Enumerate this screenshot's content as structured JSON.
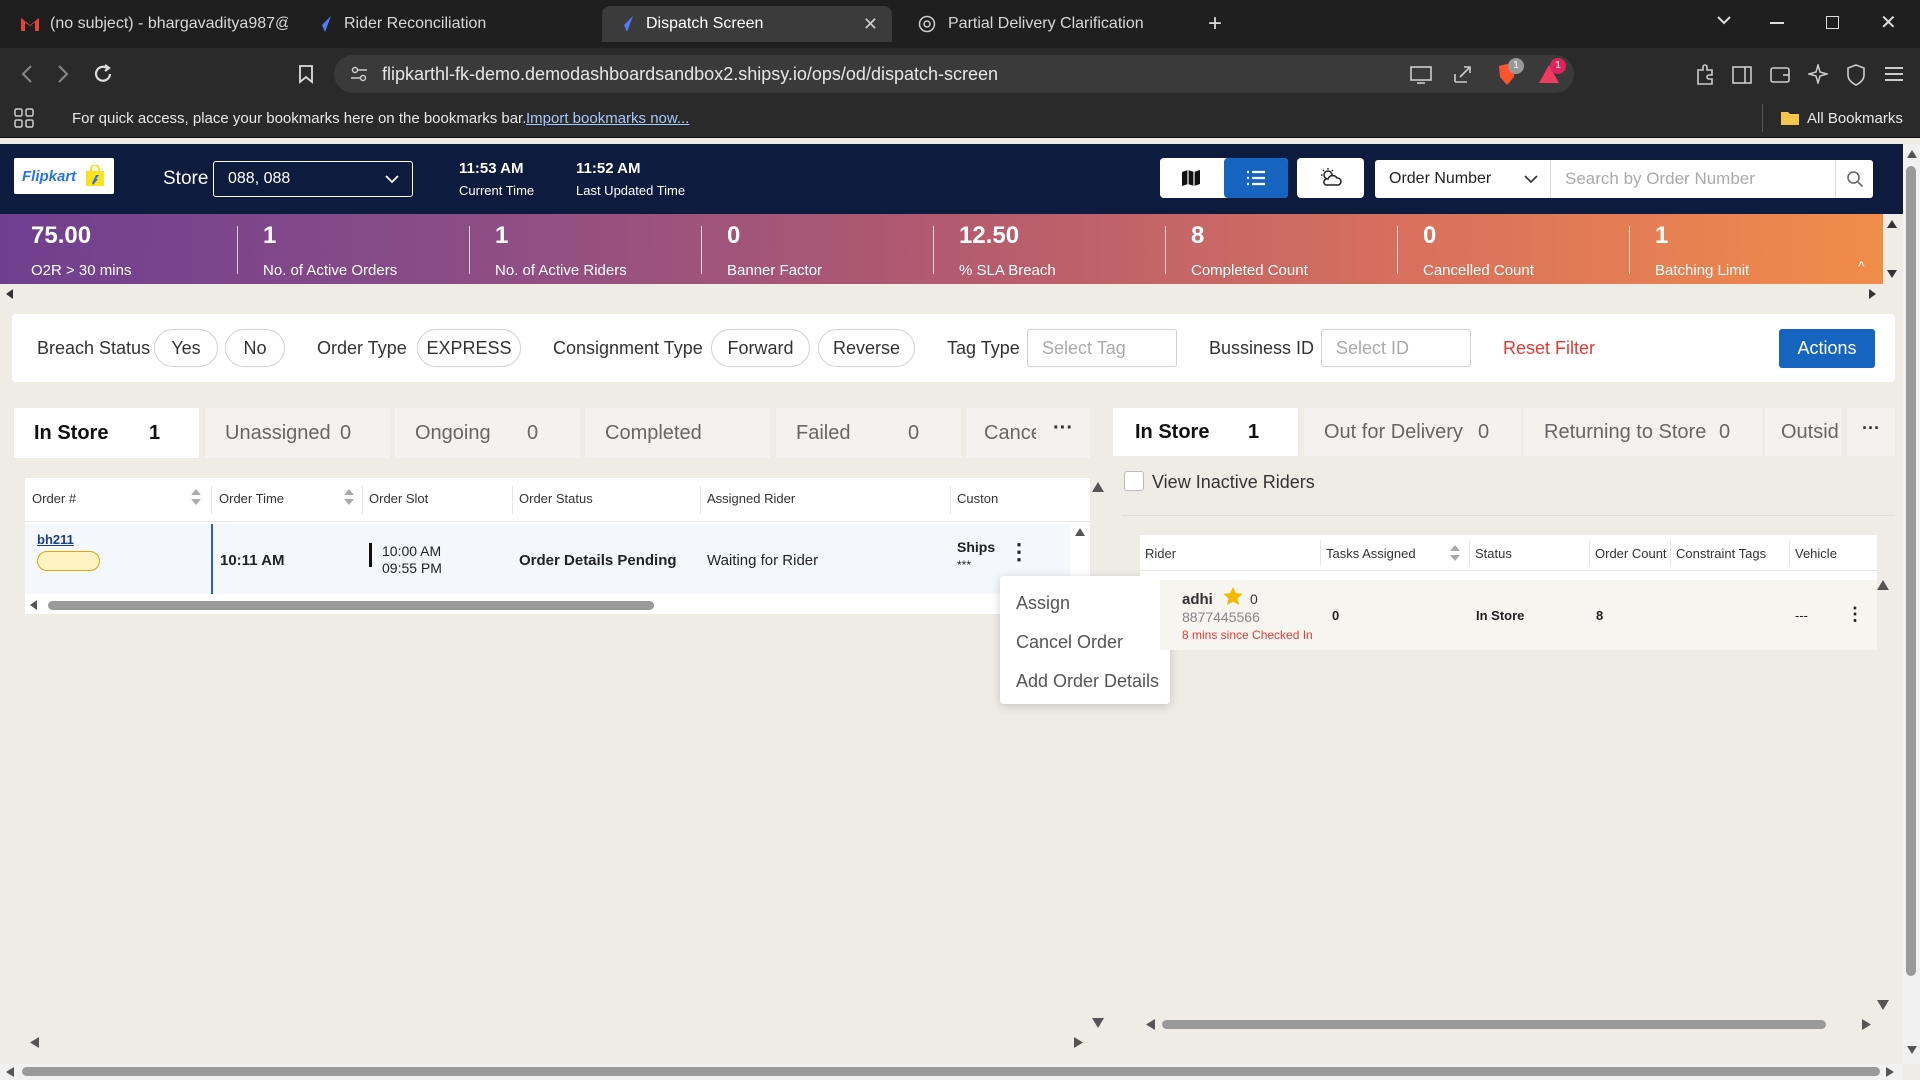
{
  "browser": {
    "tabs": [
      {
        "title": "(no subject) - bhargavaditya987@gr",
        "icon": "gmail-icon"
      },
      {
        "title": "Rider Reconciliation",
        "icon": "shipsy-icon"
      },
      {
        "title": "Dispatch Screen",
        "icon": "shipsy-icon",
        "active": true
      },
      {
        "title": "Partial Delivery Clarification",
        "icon": "globe-icon"
      }
    ],
    "url": "flipkarthl-fk-demo.demodashboardsandbox2.shipsy.io/ops/od/dispatch-screen",
    "bookmarks_hint": "For quick access, place your bookmarks here on the bookmarks bar.",
    "import_link": "Import bookmarks now...",
    "all_bookmarks": "All Bookmarks",
    "badge_brave": "1",
    "badge_alert": "1"
  },
  "header": {
    "logo": "Flipkart",
    "store_label": "Store",
    "store_value": "088, 088",
    "current_time": "11:53 AM",
    "current_time_label": "Current Time",
    "last_updated": "11:52 AM",
    "last_updated_label": "Last Updated Time",
    "search_type": "Order Number",
    "search_placeholder": "Search by Order Number"
  },
  "stats": [
    {
      "value": "75.00",
      "label": "O2R > 30 mins"
    },
    {
      "value": "1",
      "label": "No. of Active Orders"
    },
    {
      "value": "1",
      "label": "No. of Active Riders"
    },
    {
      "value": "0",
      "label": "Banner Factor"
    },
    {
      "value": "12.50",
      "label": "% SLA Breach"
    },
    {
      "value": "8",
      "label": "Completed Count"
    },
    {
      "value": "0",
      "label": "Cancelled Count"
    },
    {
      "value": "1",
      "label": "Batching Limit"
    }
  ],
  "filters": {
    "breach_status": "Breach Status",
    "yes": "Yes",
    "no": "No",
    "order_type": "Order Type",
    "express": "EXPRESS",
    "consignment_type": "Consignment Type",
    "forward": "Forward",
    "reverse": "Reverse",
    "tag_type": "Tag Type",
    "tag_placeholder": "Select Tag",
    "business_id": "Bussiness ID",
    "id_placeholder": "Select ID",
    "reset": "Reset Filter",
    "actions": "Actions"
  },
  "order_tabs": [
    {
      "label": "In Store",
      "count": "1"
    },
    {
      "label": "Unassigned",
      "count": "0"
    },
    {
      "label": "Ongoing",
      "count": "0"
    },
    {
      "label": "Completed",
      "count": ""
    },
    {
      "label": "Failed",
      "count": "0"
    },
    {
      "label": "Cance",
      "count": ""
    }
  ],
  "order_table": {
    "columns": [
      "Order #",
      "Order Time",
      "Order Slot",
      "Order Status",
      "Assigned Rider",
      "Custon"
    ],
    "rows": [
      {
        "order": "bh211",
        "time": "10:11 AM",
        "slot_start": "10:00 AM",
        "slot_end": "09:55 PM",
        "status": "Order Details Pending",
        "rider": "Waiting for Rider",
        "customer": "Ships",
        "customer_sub": "***"
      }
    ]
  },
  "context_menu": [
    "Assign",
    "Cancel Order",
    "Add Order Details"
  ],
  "rider_tabs": [
    {
      "label": "In Store",
      "count": "1"
    },
    {
      "label": "Out for Delivery",
      "count": "0"
    },
    {
      "label": "Returning to Store",
      "count": "0"
    },
    {
      "label": "Outsid",
      "count": ""
    }
  ],
  "rider_panel": {
    "inactive_label": "View Inactive Riders",
    "columns": [
      "Rider",
      "Tasks Assigned",
      "Status",
      "Order Count",
      "Constraint Tags",
      "Vehicle"
    ],
    "rows": [
      {
        "name": "adhi",
        "rating": "0",
        "phone": "8877445566",
        "note": "8 mins since Checked In",
        "tasks": "0",
        "status": "In Store",
        "order_count": "8",
        "tags": "",
        "vehicle": "---"
      }
    ]
  },
  "colors": {
    "brand_blue": "#2874f0",
    "header_bg": "#0d1b3e",
    "action_blue": "#1565c0",
    "reset_red": "#e53935"
  }
}
